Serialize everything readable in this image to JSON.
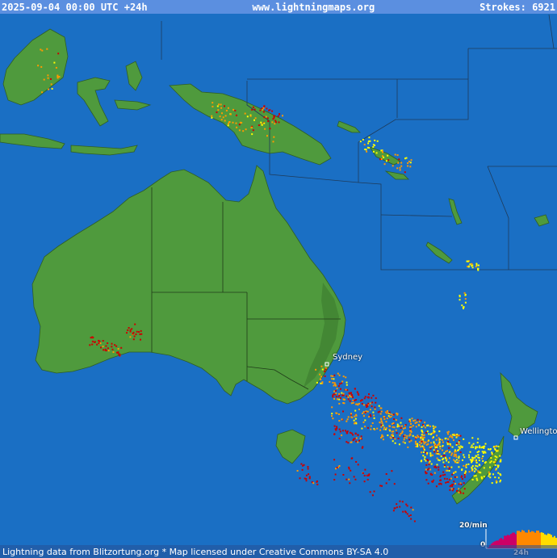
{
  "header": {
    "datetime": "2025-09-04 00:00 UTC +24h",
    "site": "www.lightningmaps.org",
    "strokes_label": "Strokes: 6921"
  },
  "cities": {
    "sydney": "Sydney",
    "wellington": "Wellingto"
  },
  "legend": {
    "rate_label": "20/min",
    "zero_label": "0",
    "period_label": "24h"
  },
  "footer": {
    "credit": "Lightning data from Blitzortung.org   *  Map licensed under Creative Commons BY-SA 4.0"
  },
  "colors": {
    "ocean": "#1a6fc4",
    "land": "#4f9a3d",
    "land_dark": "#3f7f31",
    "header_bg": "#5b8fe0",
    "strike_recent": "#ffff00",
    "strike_mid": "#ff9900",
    "strike_old": "#cc0000"
  }
}
